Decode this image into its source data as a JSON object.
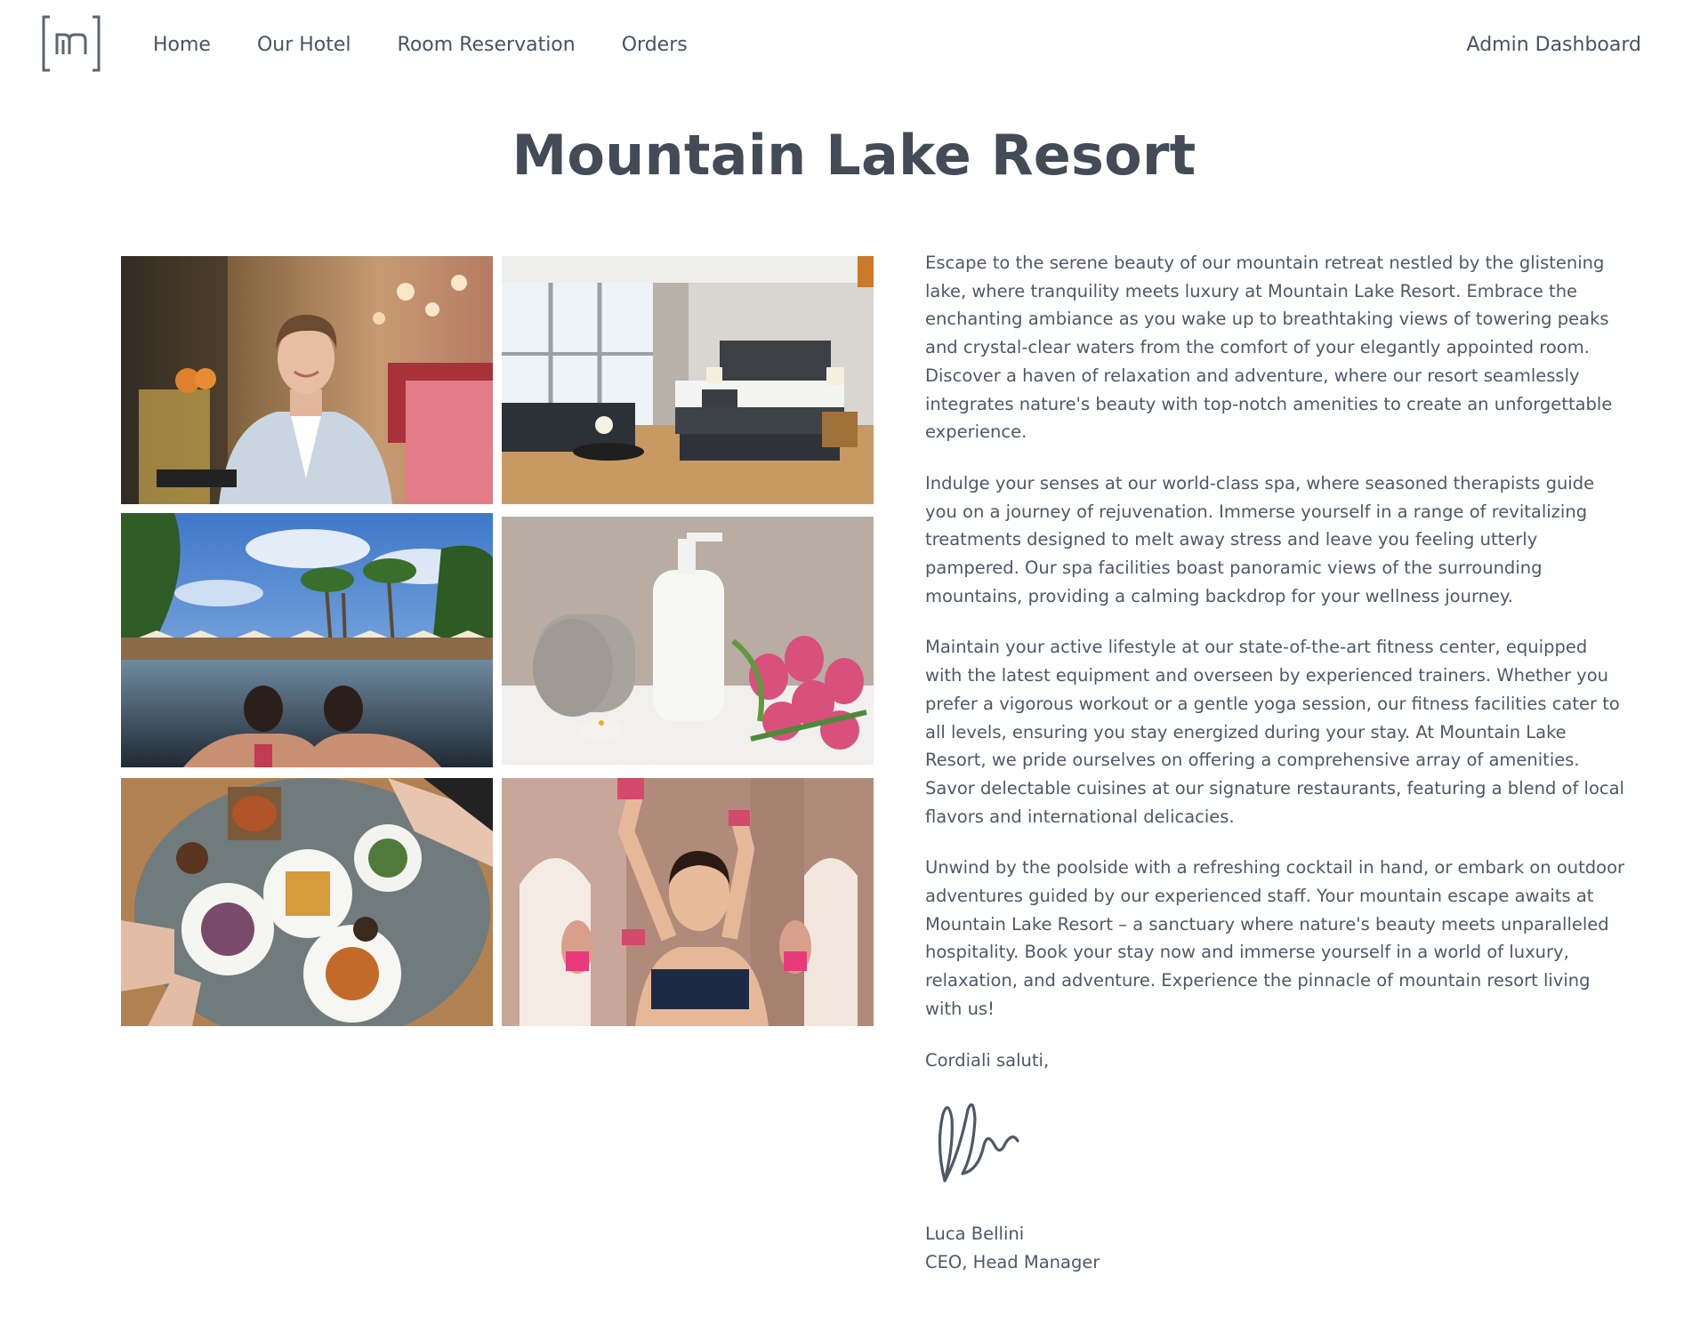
{
  "nav": {
    "logo_alt": "m",
    "links": [
      "Home",
      "Our Hotel",
      "Room Reservation",
      "Orders"
    ],
    "admin": "Admin Dashboard"
  },
  "page": {
    "title": "Mountain Lake Resort"
  },
  "gallery": {
    "photos": [
      "restaurant-host-photo",
      "hotel-bedroom-photo",
      "infinity-pool-photo",
      "spa-amenities-photo",
      "breakfast-table-photo",
      "fitness-class-photo"
    ]
  },
  "content": {
    "paragraphs": [
      "Escape to the serene beauty of our mountain retreat nestled by the glistening lake, where tranquility meets luxury at Mountain Lake Resort. Embrace the enchanting ambiance as you wake up to breathtaking views of towering peaks and crystal-clear waters from the comfort of your elegantly appointed room. Discover a haven of relaxation and adventure, where our resort seamlessly integrates nature's beauty with top-notch amenities to create an unforgettable experience.",
      "Indulge your senses at our world-class spa, where seasoned therapists guide you on a journey of rejuvenation. Immerse yourself in a range of revitalizing treatments designed to melt away stress and leave you feeling utterly pampered. Our spa facilities boast panoramic views of the surrounding mountains, providing a calming backdrop for your wellness journey.",
      "Maintain your active lifestyle at our state-of-the-art fitness center, equipped with the latest equipment and overseen by experienced trainers. Whether you prefer a vigorous workout or a gentle yoga session, our fitness facilities cater to all levels, ensuring you stay energized during your stay. At Mountain Lake Resort, we pride ourselves on offering a comprehensive array of amenities. Savor delectable cuisines at our signature restaurants, featuring a blend of local flavors and international delicacies.",
      "Unwind by the poolside with a refreshing cocktail in hand, or embark on outdoor adventures guided by our experienced staff. Your mountain escape awaits at Mountain Lake Resort – a sanctuary where nature's beauty meets unparalleled hospitality. Book your stay now and immerse yourself in a world of luxury, relaxation, and adventure. Experience the pinnacle of mountain resort living with us!"
    ],
    "closing": "Cordiali saluti,",
    "signer_name": "Luca Bellini",
    "signer_role": "CEO, Head Manager"
  },
  "colors": {
    "text": "#4f5866",
    "title": "#434b57",
    "logo": "#5b6472"
  }
}
